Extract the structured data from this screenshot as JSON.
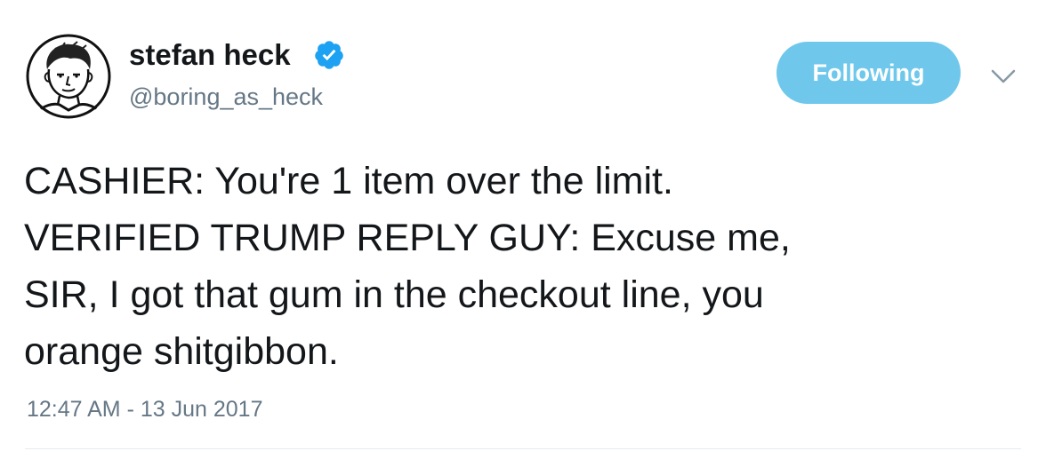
{
  "author": {
    "display_name": "stefan heck",
    "handle": "@boring_as_heck",
    "verified": true,
    "avatar_icon": "hand-drawn-portrait"
  },
  "actions": {
    "follow_label": "Following",
    "more_icon": "chevron-down-icon"
  },
  "tweet": {
    "lines": [
      "CASHIER: You're 1 item over the limit.",
      "VERIFIED TRUMP REPLY GUY: Excuse me,",
      "SIR, I got that gum in the checkout line, you",
      "orange shitgibbon."
    ],
    "timestamp": "12:47 AM - 13 Jun 2017"
  },
  "colors": {
    "follow_button": "#6fc8ec",
    "verified_badge": "#1da1f2",
    "secondary_text": "#657786",
    "primary_text": "#14171a"
  }
}
